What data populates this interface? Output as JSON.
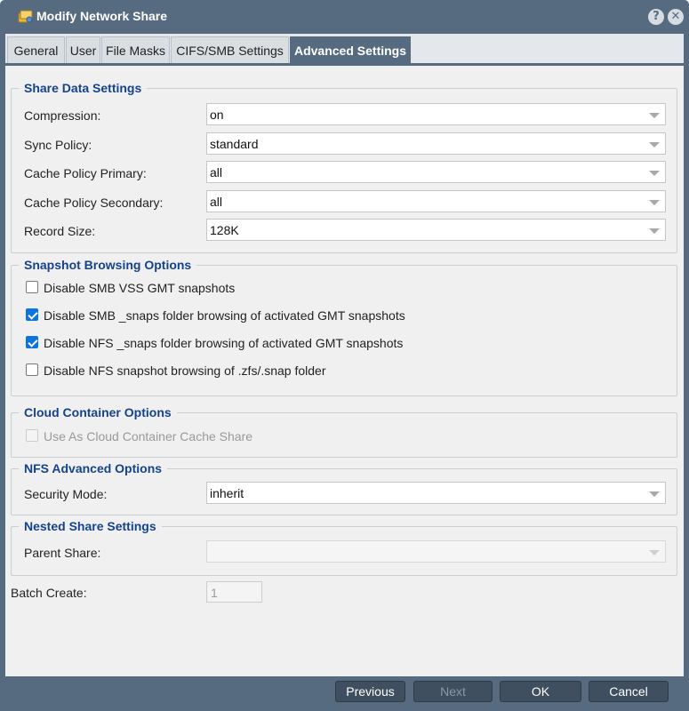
{
  "window": {
    "title": "Modify Network Share",
    "help_glyph": "?",
    "close_glyph": "✕",
    "title_icon": "share-folder-icon"
  },
  "tabs": [
    {
      "label": "General"
    },
    {
      "label": "User"
    },
    {
      "label": "File Masks"
    },
    {
      "label": "CIFS/SMB Settings"
    },
    {
      "label": "Advanced Settings",
      "active": true
    }
  ],
  "share_data": {
    "legend": "Share Data Settings",
    "fields": [
      {
        "label": "Compression:",
        "value": "on"
      },
      {
        "label": "Sync Policy:",
        "value": "standard"
      },
      {
        "label": "Cache Policy Primary:",
        "value": "all"
      },
      {
        "label": "Cache Policy Secondary:",
        "value": "all"
      },
      {
        "label": "Record Size:",
        "value": "128K"
      }
    ]
  },
  "snapshot": {
    "legend": "Snapshot Browsing Options",
    "options": [
      {
        "label": "Disable SMB VSS GMT snapshots",
        "checked": false
      },
      {
        "label": "Disable SMB _snaps folder browsing of activated GMT snapshots",
        "checked": true
      },
      {
        "label": "Disable NFS _snaps folder browsing of activated GMT snapshots",
        "checked": true
      },
      {
        "label": "Disable NFS snapshot browsing of .zfs/.snap folder",
        "checked": false
      }
    ]
  },
  "cloud": {
    "legend": "Cloud Container Options",
    "option_label": "Use As Cloud Container Cache Share",
    "checked": false
  },
  "nfs": {
    "legend": "NFS Advanced Options",
    "label": "Security Mode:",
    "value": "inherit"
  },
  "nested": {
    "legend": "Nested Share Settings",
    "label": "Parent Share:",
    "value": ""
  },
  "batch": {
    "label": "Batch Create:",
    "value": "1"
  },
  "buttons": {
    "previous": "Previous",
    "next": "Next",
    "ok": "OK",
    "cancel": "Cancel"
  },
  "colors": {
    "header": "#566b7f",
    "legend": "#15428b",
    "checkbox": "#0b74e0"
  }
}
